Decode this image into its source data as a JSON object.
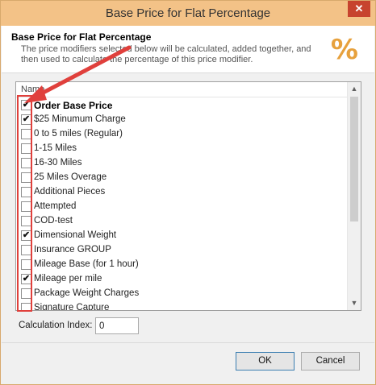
{
  "window": {
    "title": "Base Price for Flat Percentage",
    "close_glyph": "✕"
  },
  "header": {
    "title": "Base Price for Flat Percentage",
    "description": "The price modifiers selected below will be calculated, added together, and then used to calculate the percentage of this price modifier.",
    "icon": "percent-icon",
    "icon_glyph": "%"
  },
  "list": {
    "column_header": "Name",
    "items": [
      {
        "label": "Order Base Price",
        "checked": true,
        "bold": true
      },
      {
        "label": "$25 Minumum Charge",
        "checked": true,
        "bold": false
      },
      {
        "label": "0 to 5 miles (Regular)",
        "checked": false,
        "bold": false
      },
      {
        "label": "1-15 Miles",
        "checked": false,
        "bold": false
      },
      {
        "label": "16-30 Miles",
        "checked": false,
        "bold": false
      },
      {
        "label": "25 Miles Overage",
        "checked": false,
        "bold": false
      },
      {
        "label": "Additional Pieces",
        "checked": false,
        "bold": false
      },
      {
        "label": "Attempted",
        "checked": false,
        "bold": false
      },
      {
        "label": "COD-test",
        "checked": false,
        "bold": false
      },
      {
        "label": "Dimensional Weight",
        "checked": true,
        "bold": false
      },
      {
        "label": "Insurance GROUP",
        "checked": false,
        "bold": false
      },
      {
        "label": "Mileage Base (for 1 hour)",
        "checked": false,
        "bold": false
      },
      {
        "label": "Mileage per mile",
        "checked": true,
        "bold": false
      },
      {
        "label": "Package Weight Charges",
        "checked": false,
        "bold": false
      },
      {
        "label": "Signature Capture",
        "checked": false,
        "bold": false
      }
    ],
    "scroll_up_glyph": "▲",
    "scroll_down_glyph": "▼"
  },
  "calculation": {
    "label": "Calculation Index:",
    "value": "0"
  },
  "buttons": {
    "ok": "OK",
    "cancel": "Cancel"
  },
  "annotation": {
    "color": "#e0403c"
  }
}
